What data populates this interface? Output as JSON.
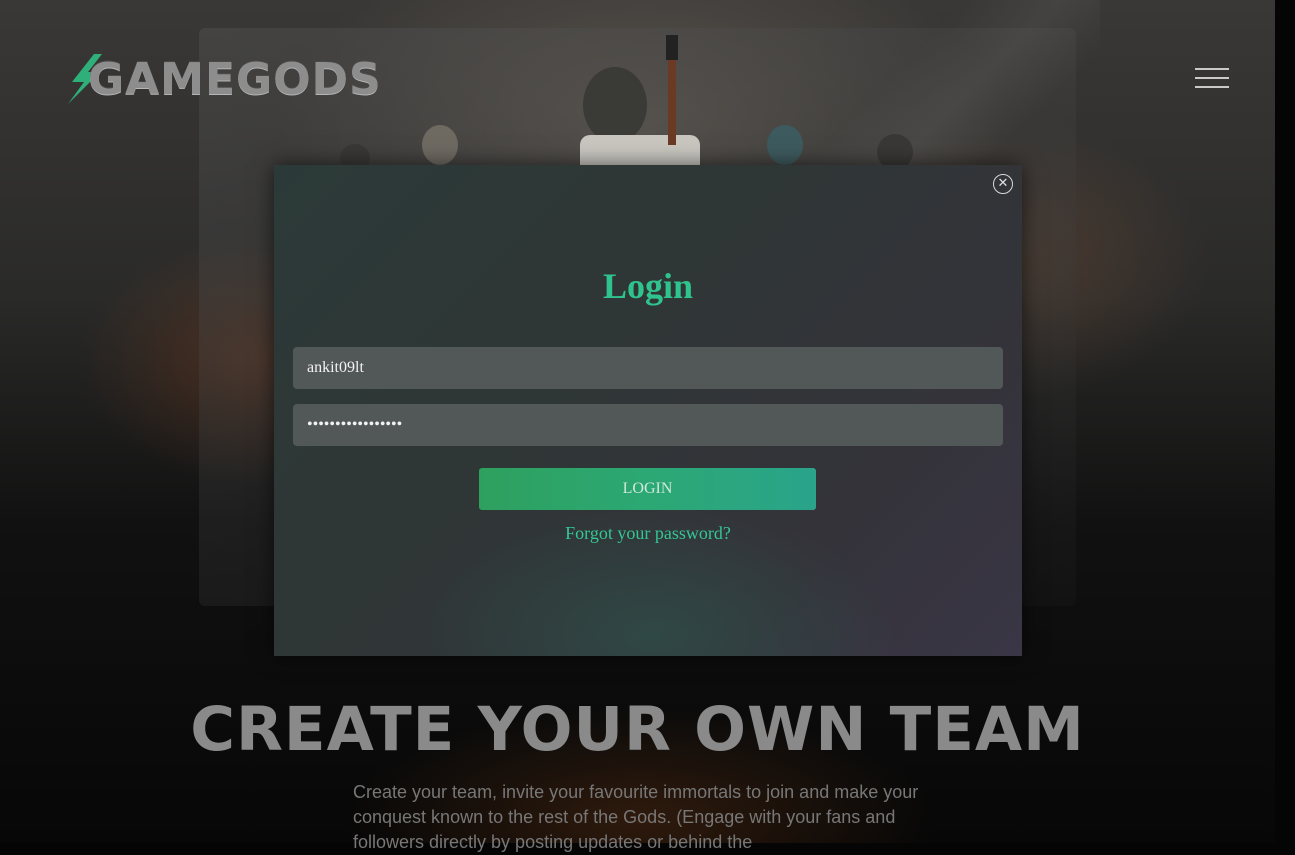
{
  "brand": {
    "logo_text": "GAMEGODS"
  },
  "header": {
    "menu_icon": "hamburger-menu-icon"
  },
  "login_modal": {
    "title": "Login",
    "close_icon": "close-circle-icon",
    "username_value": "ankit09lt",
    "password_value": "•••••••••••••••••",
    "login_label": "LOGIN",
    "forgot_label": "Forgot your password?"
  },
  "section": {
    "title": "CREATE YOUR OWN TEAM",
    "description": "Create your team, invite your favourite immortals to join and make your conquest known to the rest of the Gods. (Engage with your fans and followers directly by posting updates or behind the"
  },
  "colors": {
    "accent": "#2fc48e",
    "button": "#2ca874",
    "modal_bg": "#2f3636"
  }
}
